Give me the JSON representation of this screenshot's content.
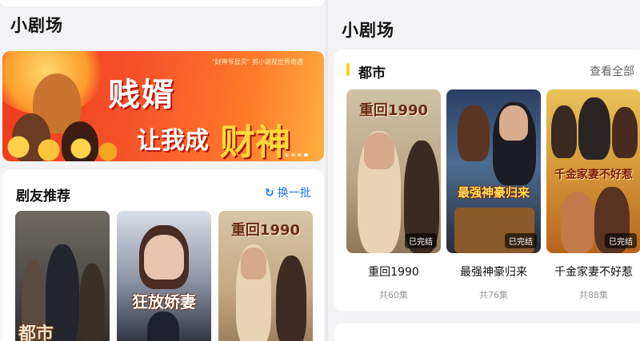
{
  "left": {
    "page_title": "小剧场",
    "banner": {
      "caption": "\"财神爷显灵\" 剪小说视世界奇遇",
      "headline": "贱婿",
      "sub1": "让我成",
      "sub2": "财神"
    },
    "recommend": {
      "title": "剧友推荐",
      "refresh_label": "换一批",
      "refresh_icon": "refresh-icon",
      "posters": [
        {
          "art_text": "都市"
        },
        {
          "art_text": "狂放娇妻"
        },
        {
          "art_text": "重回1990"
        }
      ]
    }
  },
  "right": {
    "page_title": "小剧场",
    "section": {
      "title": "都市",
      "view_all": "查看全部",
      "dramas": [
        {
          "name": "重回1990",
          "count": "共60集",
          "status": "已完结",
          "art_text": "重回1990"
        },
        {
          "name": "最强神豪归来",
          "count": "共76集",
          "status": "已完结",
          "art_text": "最强神豪归来"
        },
        {
          "name": "千金家妻不好惹",
          "count": "共88集",
          "status": "已完结",
          "art_text": "千金家妻不好惹"
        }
      ]
    }
  },
  "colors": {
    "accent_yellow": "#ffd21c",
    "link_blue": "#1a78f0",
    "banner_red": "#f03a1c"
  }
}
